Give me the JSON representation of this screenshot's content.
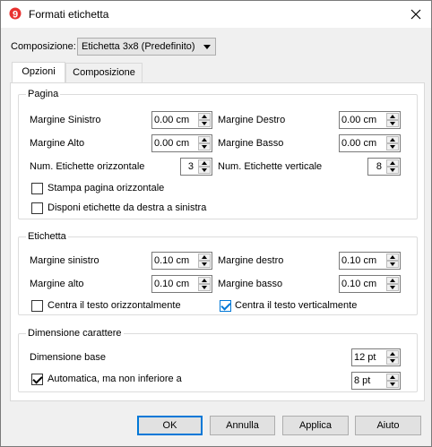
{
  "window": {
    "title": "Formati etichetta",
    "app_icon": "banana-9-icon",
    "close_icon": "close-icon"
  },
  "composition": {
    "label": "Composizione:",
    "selected": "Etichetta 3x8 (Predefinito)"
  },
  "tabs": [
    {
      "label": "Opzioni",
      "active": true
    },
    {
      "label": "Composizione",
      "active": false
    }
  ],
  "pagina": {
    "title": "Pagina",
    "margine_sinistro_label": "Margine Sinistro",
    "margine_sinistro_value": "0.00 cm",
    "margine_destro_label": "Margine Destro",
    "margine_destro_value": "0.00 cm",
    "margine_alto_label": "Margine Alto",
    "margine_alto_value": "0.00 cm",
    "margine_basso_label": "Margine Basso",
    "margine_basso_value": "0.00 cm",
    "num_orizz_label": "Num. Etichette orizzontale",
    "num_orizz_value": "3",
    "num_vert_label": "Num. Etichette verticale",
    "num_vert_value": "8",
    "stampa_orizz_label": "Stampa pagina orizzontale",
    "stampa_orizz_checked": false,
    "disponi_label": "Disponi etichette da destra a sinistra",
    "disponi_checked": false
  },
  "etichetta": {
    "title": "Etichetta",
    "margine_sinistro_label": "Margine sinistro",
    "margine_sinistro_value": "0.10 cm",
    "margine_destro_label": "Margine destro",
    "margine_destro_value": "0.10 cm",
    "margine_alto_label": "Margine alto",
    "margine_alto_value": "0.10 cm",
    "margine_basso_label": "Margine basso",
    "margine_basso_value": "0.10 cm",
    "centra_orizz_label": "Centra il testo orizzontalmente",
    "centra_orizz_checked": false,
    "centra_vert_label": "Centra il testo verticalmente",
    "centra_vert_checked": true
  },
  "dimensione": {
    "title": "Dimensione carattere",
    "base_label": "Dimensione base",
    "base_value": "12 pt",
    "auto_label": "Automatica, ma non inferiore a",
    "auto_checked": true,
    "auto_value": "8 pt"
  },
  "buttons": {
    "ok": "OK",
    "annulla": "Annulla",
    "applica": "Applica",
    "aiuto": "Aiuto"
  },
  "colors": {
    "accent": "#0078d7",
    "app_icon_red": "#e8312f"
  }
}
